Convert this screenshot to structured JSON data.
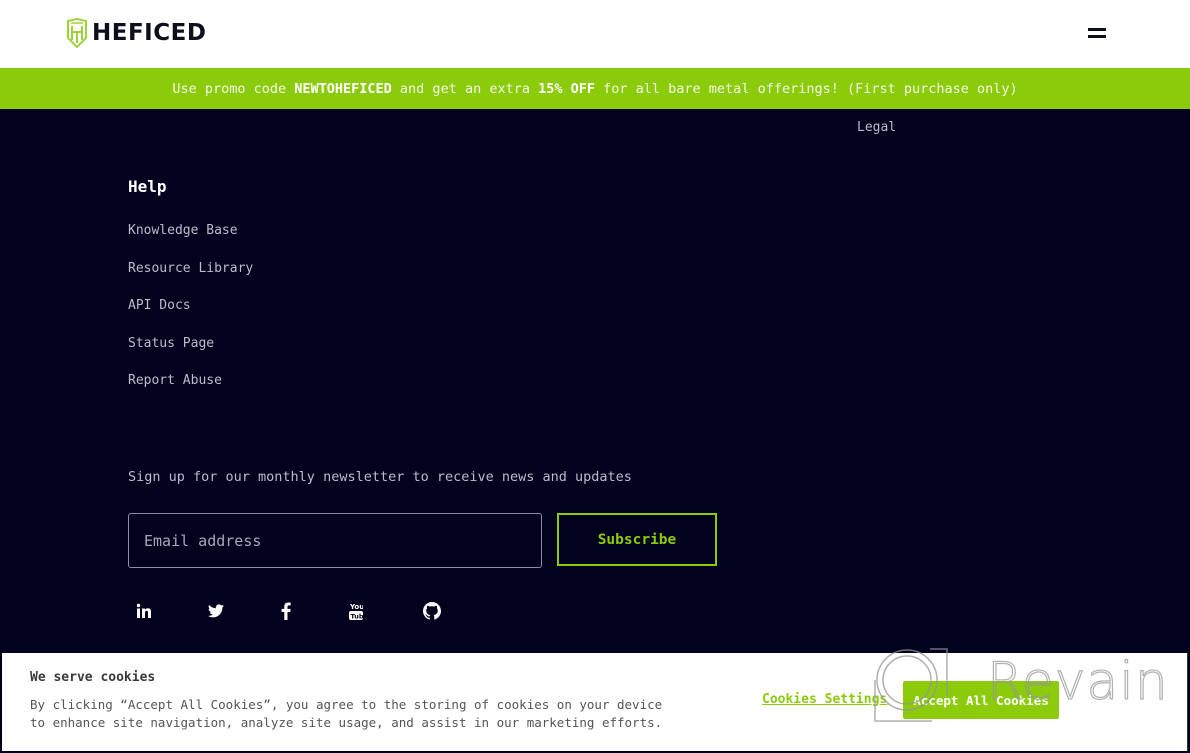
{
  "header": {
    "brand": "HEFICED",
    "menu_icon": "hamburger-menu-icon"
  },
  "promo": {
    "prefix": "Use promo code ",
    "code": "NEWTOHEFICED",
    "middle": " and get an extra ",
    "discount": "15% OFF",
    "suffix": " for all bare metal offerings! (First purchase only)"
  },
  "footer": {
    "legal_link": "Legal",
    "help": {
      "title": "Help",
      "items": [
        {
          "label": "Knowledge Base"
        },
        {
          "label": "Resource Library"
        },
        {
          "label": "API Docs"
        },
        {
          "label": "Status Page"
        },
        {
          "label": "Report Abuse"
        }
      ]
    },
    "newsletter": {
      "text": "Sign up for our monthly newsletter to receive news and updates",
      "email_placeholder": "Email address",
      "email_value": "",
      "subscribe_label": "Subscribe"
    },
    "social": [
      {
        "name": "linkedin-icon"
      },
      {
        "name": "twitter-icon"
      },
      {
        "name": "facebook-icon"
      },
      {
        "name": "youtube-icon"
      },
      {
        "name": "github-icon"
      }
    ]
  },
  "cookie_banner": {
    "title": "We serve cookies",
    "body": "By clicking “Accept All Cookies”, you agree to the storing of cookies on your device to enhance site navigation, analyze site usage, and assist in our marketing efforts.",
    "settings_label": "Cookies Settings",
    "accept_label": "Accept All Cookies"
  },
  "watermark": {
    "text": "Revain"
  },
  "colors": {
    "accent": "#8bcb0c",
    "footer_bg": "#02021e",
    "header_bg": "#ffffff"
  }
}
